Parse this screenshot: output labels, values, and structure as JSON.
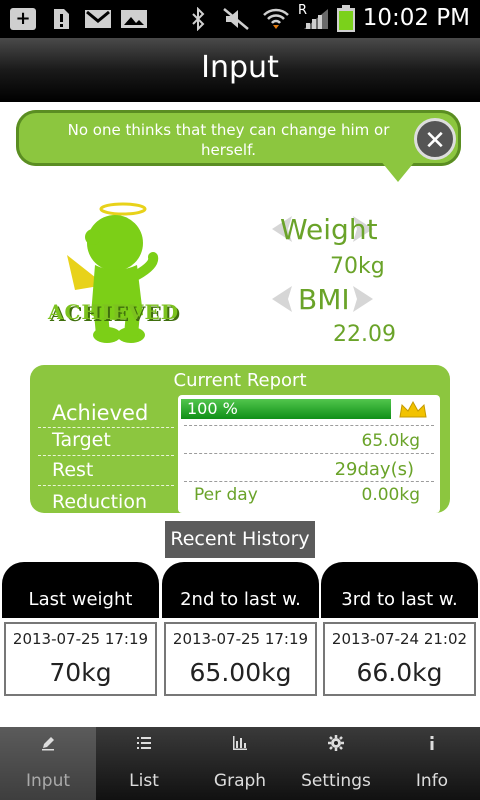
{
  "status_bar": {
    "time": "10:02 PM",
    "roaming_letter": "R"
  },
  "header": {
    "title": "Input"
  },
  "bubble": {
    "message": "No one thinks that they can change him or herself.",
    "close_symbol": "✕"
  },
  "character": {
    "badge_text": "ACHIEVED"
  },
  "metrics": {
    "weight_label": "Weight",
    "weight_value": "70kg",
    "bmi_label": "BMI",
    "bmi_value": "22.09"
  },
  "report": {
    "title": "Current Report",
    "achieved_label": "Achieved",
    "progress_text": "100 %",
    "progress_fraction": 1.0,
    "target_label": "Target",
    "target_value": "65.0kg",
    "rest_label": "Rest",
    "rest_value": "29day(s)",
    "reduction_label": "Reduction",
    "per_day_label": "Per day",
    "per_day_value": "0.00kg"
  },
  "history": {
    "label": "Recent History",
    "cards": [
      {
        "header": "Last weight",
        "date": "2013-07-25 17:19",
        "value": "70kg"
      },
      {
        "header": "2nd to last w.",
        "date": "2013-07-25 17:19",
        "value": "65.00kg"
      },
      {
        "header": "3rd to last w.",
        "date": "2013-07-24 21:02",
        "value": "66.0kg"
      }
    ]
  },
  "nav": {
    "items": [
      {
        "label": "Input",
        "icon": "pencil-icon"
      },
      {
        "label": "List",
        "icon": "list-icon"
      },
      {
        "label": "Graph",
        "icon": "bar-chart-icon"
      },
      {
        "label": "Settings",
        "icon": "gear-icon"
      },
      {
        "label": "Info",
        "icon": "info-icon"
      }
    ]
  },
  "colors": {
    "accent_green": "#8cc63f",
    "text_green": "#6aa329",
    "progress_green": "#1fa127"
  }
}
